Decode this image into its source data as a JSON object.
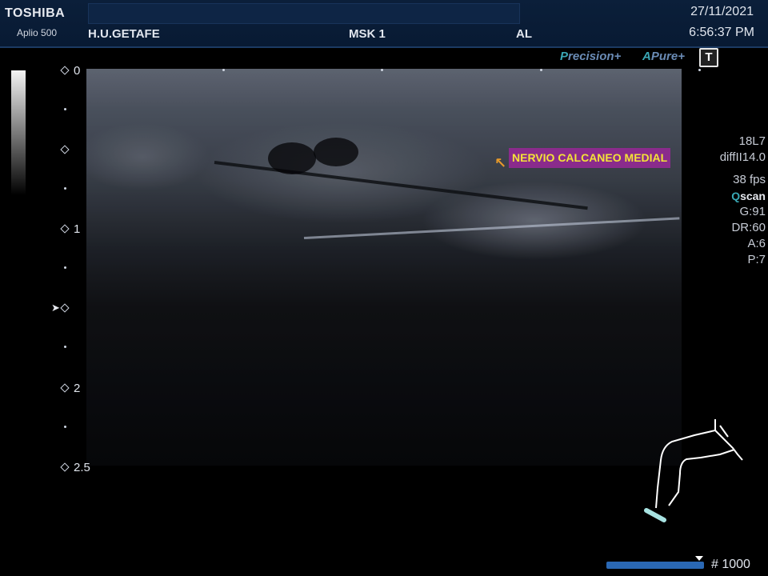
{
  "header": {
    "brand": "TOSHIBA",
    "model": "Aplio 500",
    "hospital": "H.U.GETAFE",
    "preset": "MSK 1",
    "operator": "AL",
    "date": "27/11/2021",
    "time": "6:56:37 PM"
  },
  "toolbar": {
    "precision_lead": "P",
    "precision_rest": "recision",
    "precision_plus": "+",
    "apure_lead": "A",
    "apure_rest": "Pure",
    "apure_plus": "+",
    "t_button": "T"
  },
  "depth_scale": {
    "labels": [
      "0",
      "1",
      "2",
      "2.5"
    ],
    "focus_symbol": "➤"
  },
  "annotation": {
    "text": "NERVIO CALCANEO MEDIAL",
    "arrow": "↖"
  },
  "params": {
    "probe": "18L7",
    "mode": "diffII14.0",
    "fps": "38 fps",
    "qscan_q": "Q",
    "qscan_rest": "scan",
    "gain": "G:91",
    "dynamic_range": "DR:60",
    "a": "A:6",
    "p": "P:7"
  },
  "cine": {
    "frame_count": "# 1000",
    "position": 0.95
  },
  "icons": {
    "body_mark": "leg-bodymark-icon",
    "probe_mark": "probe-position-icon"
  },
  "colors": {
    "annotation_bg": "#8a2b8c",
    "annotation_text": "#f3e338",
    "accent_teal": "#3aa7b5",
    "progress": "#2a68b4"
  }
}
